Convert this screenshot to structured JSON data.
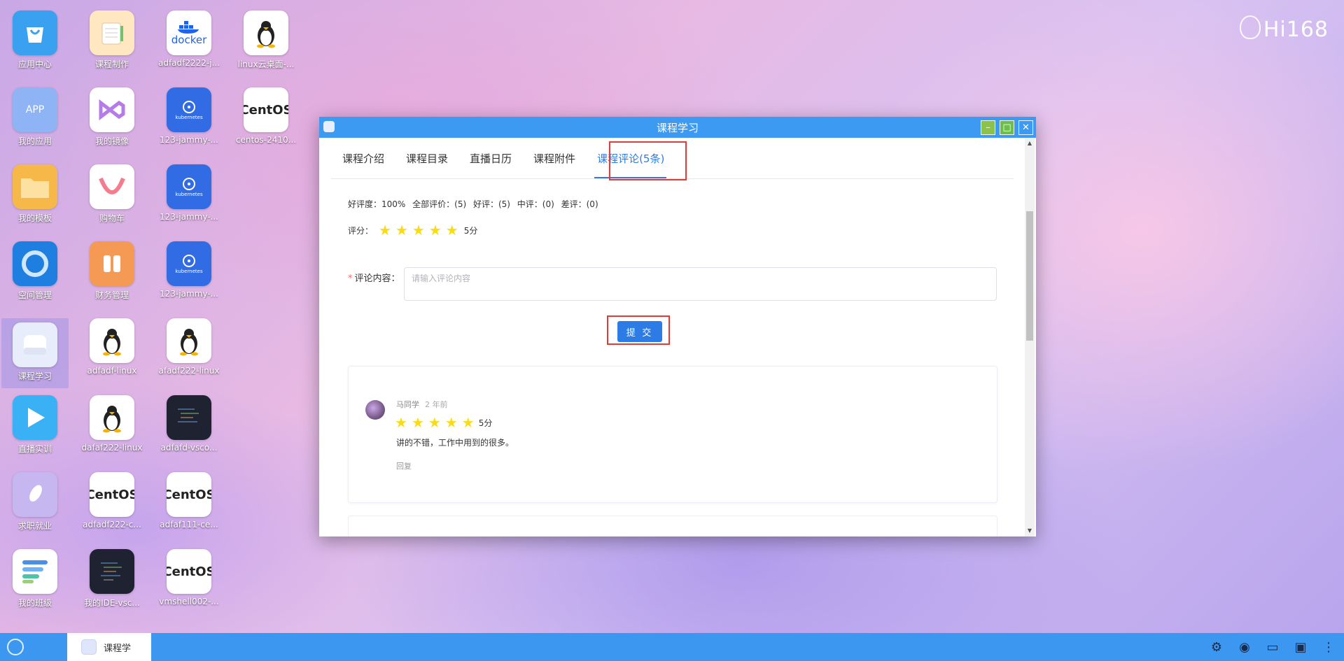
{
  "desktop": {
    "brand": "Hi168",
    "icons": [
      {
        "label": "应用中心"
      },
      {
        "label": "课程制作"
      },
      {
        "label": "adfadf2222-j..."
      },
      {
        "label": "linux云桌面-..."
      },
      {
        "label": "我的应用",
        "tile_text": "APP"
      },
      {
        "label": "我的镜像"
      },
      {
        "label": "123-jammy-..."
      },
      {
        "label": "centos-2410..."
      },
      {
        "label": "我的模板"
      },
      {
        "label": "购物车"
      },
      {
        "label": "123-jammy-..."
      },
      {
        "label": "空间管理"
      },
      {
        "label": "财务管理"
      },
      {
        "label": "123-jammy-..."
      },
      {
        "label": "课程学习"
      },
      {
        "label": "adfadf-linux"
      },
      {
        "label": "afadf222-linux"
      },
      {
        "label": "直播实训"
      },
      {
        "label": "dafaf222-linux"
      },
      {
        "label": "adfafd-vsco..."
      },
      {
        "label": "求职就业"
      },
      {
        "label": "adfadf222-c..."
      },
      {
        "label": "adfaf111-ce..."
      },
      {
        "label": "我的班级"
      },
      {
        "label": "我的IDE-vsc..."
      },
      {
        "label": "vmshell002-..."
      }
    ],
    "tile_texts": {
      "docker": "docker",
      "kubernetes": "kubernetes",
      "centos": "CentOS"
    }
  },
  "window": {
    "title": "课程学习",
    "tabs": [
      {
        "label": "课程介绍"
      },
      {
        "label": "课程目录"
      },
      {
        "label": "直播日历"
      },
      {
        "label": "课程附件"
      },
      {
        "label": "课程评论(5条)"
      }
    ],
    "stats": {
      "good_rate": "好评度：100%",
      "all": "全部评价：(5)",
      "good": "好评：(5)",
      "medium": "中评：(0)",
      "bad": "差评：(0)"
    },
    "rating_label": "评分：",
    "rating_value": 5,
    "rating_text": "5分",
    "comment_label": "评论内容：",
    "comment_required_mark": "*",
    "comment_placeholder": "请输入评论内容",
    "submit_label": "提 交",
    "reviews": [
      {
        "user": "马同学",
        "time": "2 年前",
        "stars": 5,
        "score_text": "5分",
        "text": "讲的不错，工作中用到的很多。",
        "reply_label": "回复"
      }
    ]
  },
  "taskbar": {
    "active_item": "课程学"
  },
  "colors": {
    "accent": "#2d7be5",
    "titlebar": "#3d9af2",
    "taskbar": "#3b97f0",
    "star": "#fadb14",
    "highlight": "#e53935"
  }
}
